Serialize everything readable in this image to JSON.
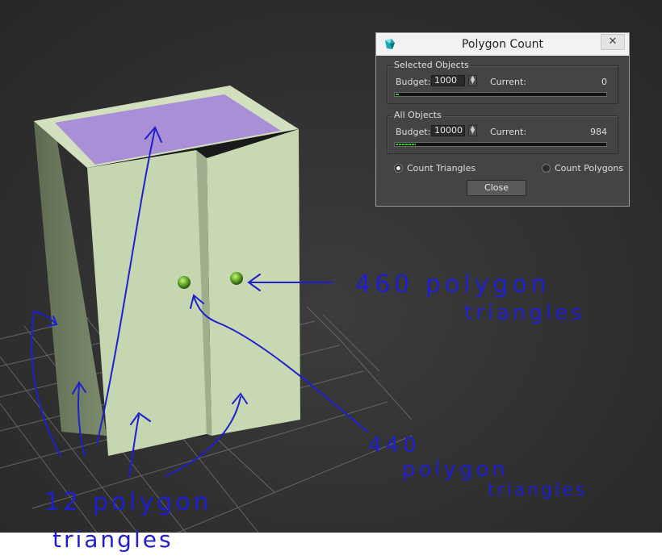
{
  "dialog": {
    "title": "Polygon Count",
    "close_icon": "close-icon",
    "selected": {
      "title": "Selected Objects",
      "budget_label": "Budget:",
      "budget_value": "1000",
      "current_label": "Current:",
      "current_value": "0",
      "progress": 0.0
    },
    "all": {
      "title": "All Objects",
      "budget_label": "Budget:",
      "budget_value": "10000",
      "current_label": "Current:",
      "current_value": "984",
      "progress": 0.098
    },
    "count_triangles": "Count Triangles",
    "count_polygons": "Count Polygons",
    "selected_mode": "triangles",
    "close_button": "Close"
  },
  "annotations": {
    "knobs_line1": "460 polygon",
    "knobs_line2": "triangles",
    "doors_line1": "440",
    "doors_line2": "polygon",
    "doors_line3": "triangles",
    "body_line1": "12 polygon",
    "body_line2": "triangles"
  },
  "colors": {
    "viewport_bg": "#2a2a2a",
    "cabinet": "#c5d6b0",
    "cabinet_top": "#a98fd6",
    "annotation_ink": "#1f1fd0",
    "progress_green": "#36c436"
  }
}
